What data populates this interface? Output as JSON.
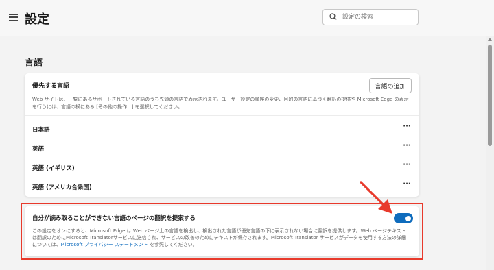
{
  "header": {
    "title": "設定",
    "search_placeholder": "設定の検索"
  },
  "section_title": "言語",
  "preferred_languages": {
    "title": "優先する言語",
    "add_button": "言語の追加",
    "description": "Web サイトは、一覧にあるサポートされている言語のうち先頭の言語で表示されます。ユーザー設定の順序の変更、目的の言語に基づく翻訳の提供や Microsoft Edge の表示を行うには、言語の横にある [その他の操作...] を選択してください。",
    "languages": [
      {
        "label": "日本語",
        "more": "···"
      },
      {
        "label": "英語",
        "more": "···"
      },
      {
        "label": "英語 (イギリス)",
        "more": "···"
      },
      {
        "label": "英語 (アメリカ合衆国)",
        "more": "···"
      }
    ]
  },
  "translate_offer": {
    "title": "自分が読み取ることができない言語のページの翻訳を提案する",
    "description_pre": "この設定をオンにすると、Microsoft Edge は Web ページ上の言語を検出し、検出された言語が優先言語の下に表示されない場合に翻訳を提供します。Web ページテキストは翻訳のためにMicrosoft Translatorサービスに送信され、サービスの改善のためにテキストが保存されます。Microsoft Translator サービスがデータを使用する方法の詳細については、",
    "link_text": "Microsoft プライバシー ステートメント",
    "description_post": " を参照してください。",
    "enabled": true
  },
  "icons": {
    "menu": "hamburger-menu-icon",
    "search": "search-icon",
    "more": "more-options-icon"
  },
  "colors": {
    "accent": "#0f6cbd",
    "annotation": "#e83a2c"
  }
}
